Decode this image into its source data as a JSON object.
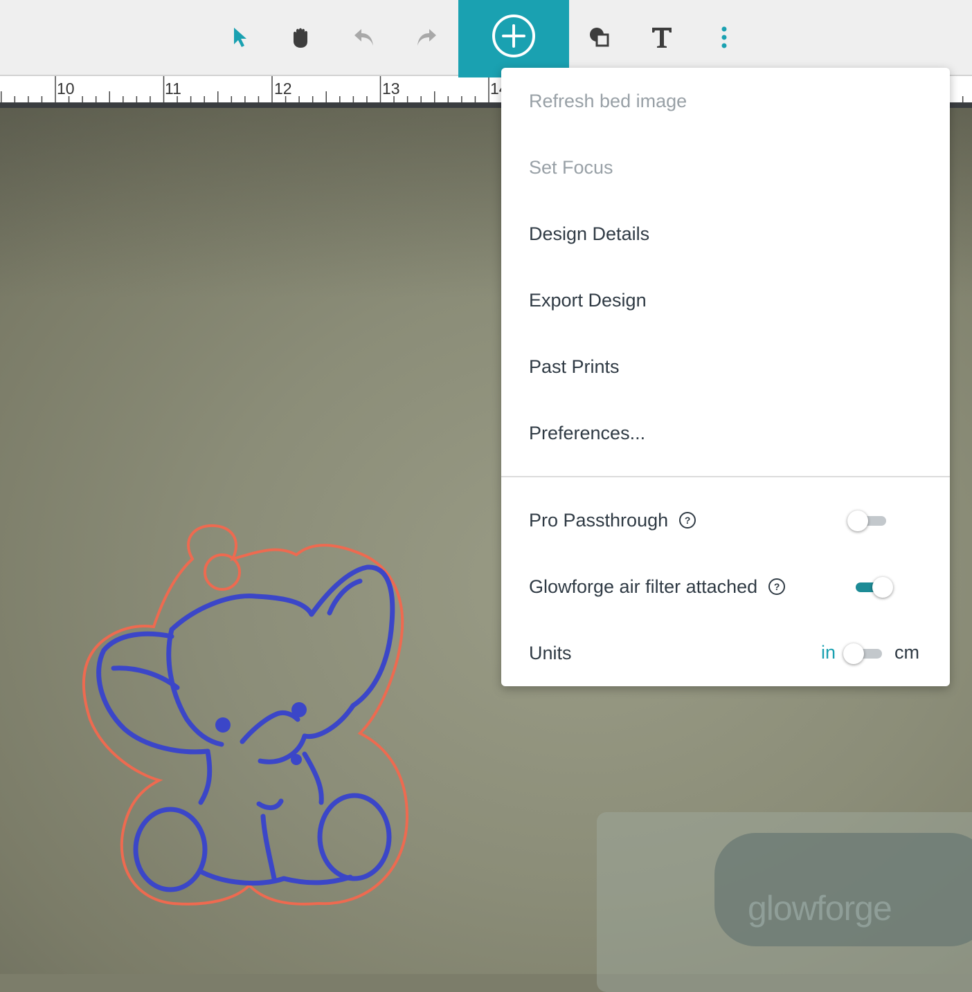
{
  "toolbar": {
    "tools": [
      {
        "name": "select-tool",
        "icon": "pointer-arrow-icon",
        "color": "#1aa1b1"
      },
      {
        "name": "pan-tool",
        "icon": "hand-icon",
        "color": "#3d3d3d"
      },
      {
        "name": "undo-tool",
        "icon": "undo-icon",
        "color": "#a8a8a8"
      },
      {
        "name": "redo-tool",
        "icon": "redo-icon",
        "color": "#a8a8a8"
      },
      {
        "name": "add-artwork",
        "icon": "plus-circle-icon",
        "color": "#1aa1b1"
      },
      {
        "name": "shapes-tool",
        "icon": "shapes-icon",
        "color": "#3d3d3d"
      },
      {
        "name": "text-tool",
        "icon": "text-T-icon",
        "color": "#3d3d3d"
      },
      {
        "name": "more-menu",
        "icon": "vertical-dots-icon",
        "color": "#1aa1b1"
      }
    ]
  },
  "ruler": {
    "labels": [
      "10",
      "11",
      "12",
      "13",
      "14"
    ]
  },
  "menu": {
    "items": [
      {
        "label": "Refresh bed image",
        "enabled": false
      },
      {
        "label": "Set Focus",
        "enabled": false
      },
      {
        "label": "Design Details",
        "enabled": true
      },
      {
        "label": "Export Design",
        "enabled": true
      },
      {
        "label": "Past Prints",
        "enabled": true
      },
      {
        "label": "Preferences...",
        "enabled": true
      }
    ],
    "settings": {
      "pro_passthrough": {
        "label": "Pro Passthrough",
        "help": "?",
        "on": false
      },
      "air_filter": {
        "label": "Glowforge air filter attached",
        "help": "?",
        "on": true
      },
      "units": {
        "label": "Units",
        "left": "in",
        "right": "cm",
        "selected": "in"
      }
    }
  },
  "bed": {
    "logo_text": "glowforge",
    "design": {
      "name": "elephant-keychain",
      "cut_color": "#ee6a50",
      "engrave_color": "#3b46c8"
    }
  },
  "colors": {
    "accent": "#1aa1b1",
    "toolbar_bg": "#efefef",
    "text": "#2f3a44",
    "disabled_text": "#98a0a6"
  }
}
